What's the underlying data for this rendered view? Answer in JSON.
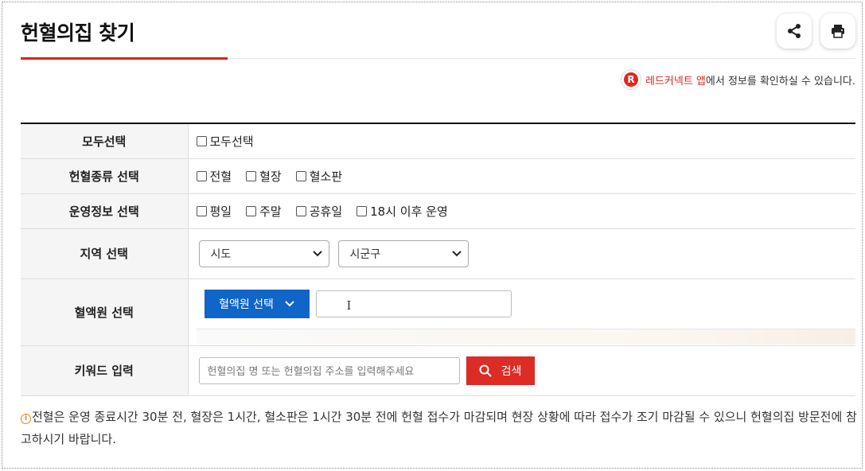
{
  "page": {
    "title": "헌혈의집 찾기"
  },
  "toolbar": {
    "share_icon": "share-icon",
    "print_icon": "print-icon"
  },
  "app_notice": {
    "logo_letter": "R",
    "app_name": "레드커넥트 앱",
    "text": "에서 정보를 확인하실 수 있습니다."
  },
  "form": {
    "select_all": {
      "label": "모두선택",
      "options": [
        {
          "label": "모두선택",
          "checked": false
        }
      ]
    },
    "donation_type": {
      "label": "헌혈종류 선택",
      "options": [
        {
          "label": "전혈",
          "checked": false
        },
        {
          "label": "혈장",
          "checked": false
        },
        {
          "label": "혈소판",
          "checked": false
        }
      ]
    },
    "operation": {
      "label": "운영정보 선택",
      "options": [
        {
          "label": "평일",
          "checked": false
        },
        {
          "label": "주말",
          "checked": false
        },
        {
          "label": "공휴일",
          "checked": false
        },
        {
          "label": "18시 이후 운영",
          "checked": false
        }
      ]
    },
    "region": {
      "label": "지역 선택",
      "sido_value": "시도",
      "sigungu_value": "시군구"
    },
    "blood_center": {
      "label": "혈액원 선택",
      "button_label": "혈액원 선택",
      "input_value": ""
    },
    "keyword": {
      "label": "키워드 입력",
      "placeholder": "헌혈의집 명 또는 헌혈의집 주소를 입력해주세요",
      "search_label": "검색"
    }
  },
  "footnote": {
    "icon": "info-icon",
    "text": "전혈은 운영 종료시간 30분 전, 혈장은 1시간, 혈소판은 1시간 30분 전에 헌혈 접수가 마감되며 현장 상황에 따라 접수가 조기 마감될 수 있으니 헌혈의집 방문전에 참고하시기 바랍니다."
  },
  "colors": {
    "accent_red": "#d9241c",
    "button_blue": "#1065c8",
    "search_red": "#dd2b25",
    "info_orange": "#e0861a"
  }
}
